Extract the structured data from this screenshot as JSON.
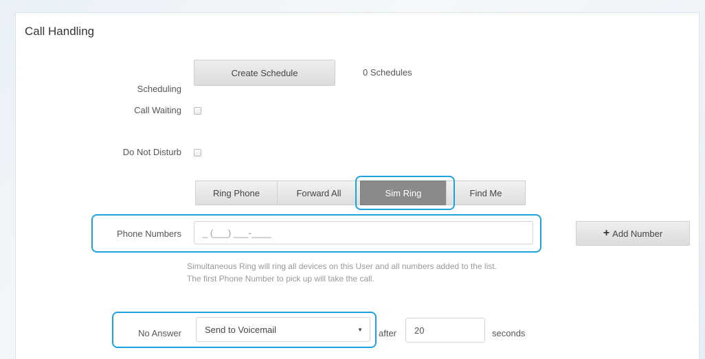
{
  "call_handling": {
    "title": "Call Handling",
    "scheduling": {
      "label": "Scheduling",
      "button": "Create Schedule",
      "count": "0 Schedules"
    },
    "call_waiting": {
      "label": "Call Waiting",
      "checked": false
    },
    "do_not_disturb": {
      "label": "Do Not Disturb",
      "checked": false
    },
    "modes": [
      "Ring Phone",
      "Forward All",
      "Sim Ring",
      "Find Me"
    ],
    "active_mode": "Sim Ring",
    "phone_numbers": {
      "label": "Phone Numbers",
      "placeholder": "_ (___) ___-____",
      "add_button": "Add Number",
      "add_icon": "+"
    },
    "help_text": "Simultaneous Ring will ring all devices on this User and all numbers added to the list. The first Phone Number to pick up will take the call.",
    "no_answer": {
      "label": "No Answer",
      "selected": "Send to Voicemail",
      "after_label": "after",
      "seconds_value": "20",
      "seconds_label": "seconds"
    },
    "highlight_color": "#1aa3e0"
  }
}
